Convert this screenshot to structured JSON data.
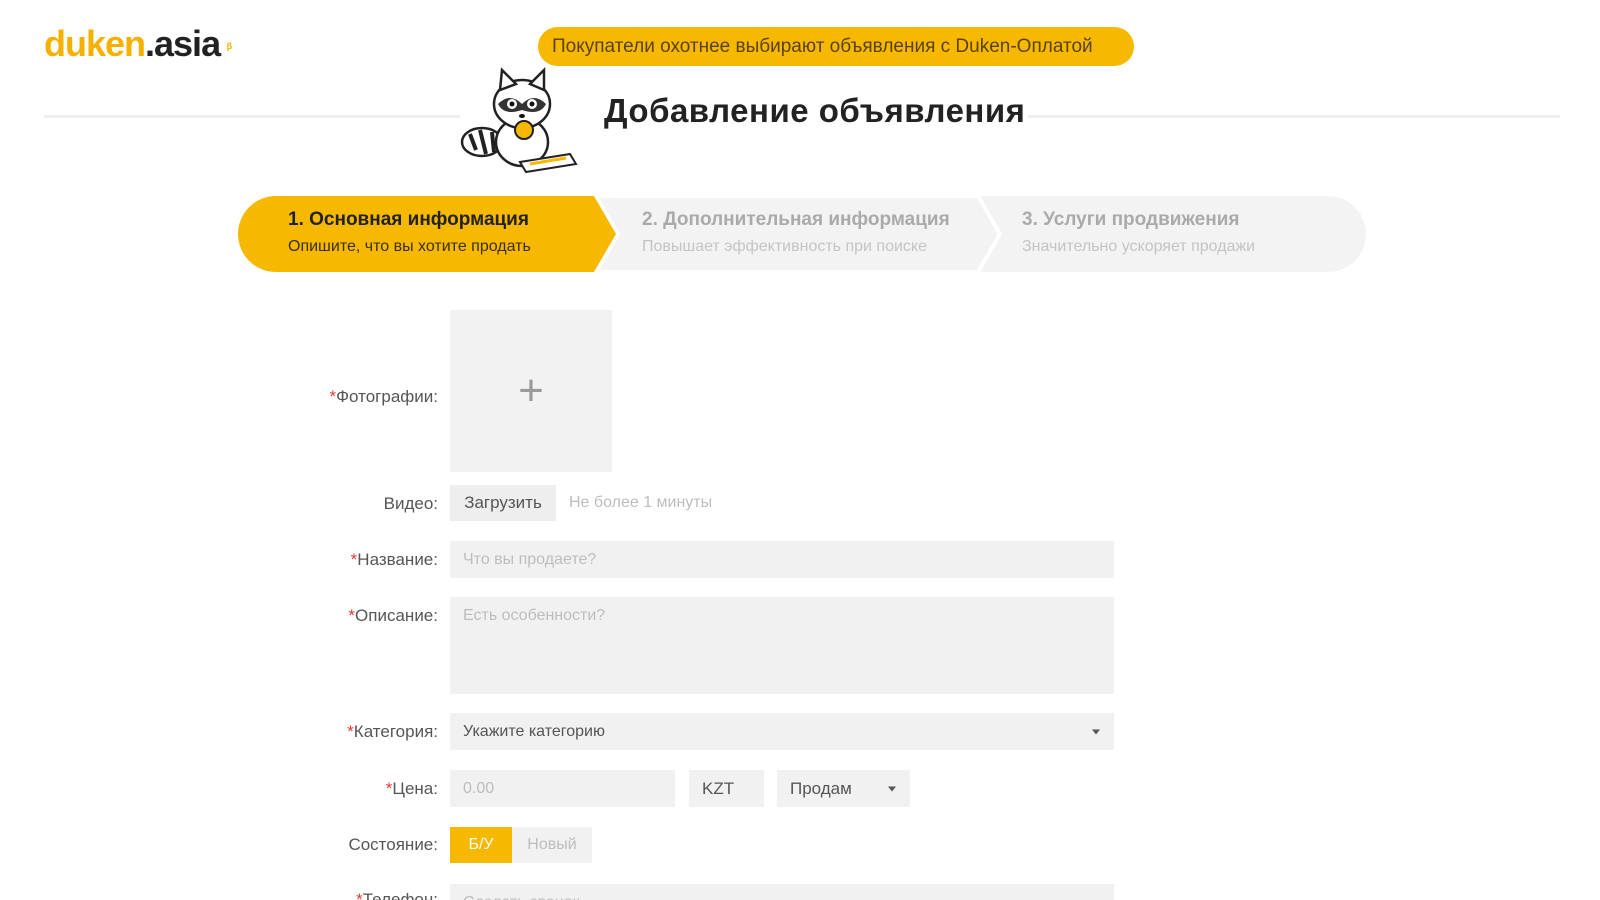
{
  "header": {
    "logo_main": "duken",
    "logo_domain": ".asia",
    "logo_badge": "β",
    "promo_banner": "Покупатели охотнее выбирают объявления с Duken-Оплатой",
    "page_title": "Добавление объявления"
  },
  "stepper": {
    "active_color": "#F6B800",
    "steps": [
      {
        "title": "1. Основная информация",
        "subtitle": "Опишите, что вы хотите продать",
        "active": true
      },
      {
        "title": "2. Дополнительная информация",
        "subtitle": "Повышает эффективность при поиске",
        "active": false
      },
      {
        "title": "3. Услуги продвижения",
        "subtitle": "Значительно ускоряет продажи",
        "active": false
      }
    ]
  },
  "form": {
    "required_mark": "*",
    "photos": {
      "label": "Фотографии:",
      "add_icon": "+"
    },
    "video": {
      "label": "Видео:",
      "upload_label": "Загрузить",
      "hint": "Не более 1 минуты"
    },
    "name": {
      "label": "Название:",
      "placeholder": "Что вы продаете?"
    },
    "description": {
      "label": "Описание:",
      "placeholder": "Есть особенности?"
    },
    "category": {
      "label": "Категория:",
      "value": "Укажите категорию"
    },
    "price": {
      "label": "Цена:",
      "placeholder": "0.00",
      "currency": "KZT",
      "deal_type": "Продам"
    },
    "condition": {
      "label": "Состояние:",
      "options": [
        "Б/У",
        "Новый"
      ],
      "selected": "Б/У"
    },
    "phone": {
      "label": "Телефон:",
      "placeholder": "Сделать звонок"
    }
  },
  "colors": {
    "brand": "#F6B800",
    "required": "#e53935",
    "field_bg": "#f1f1f1"
  }
}
